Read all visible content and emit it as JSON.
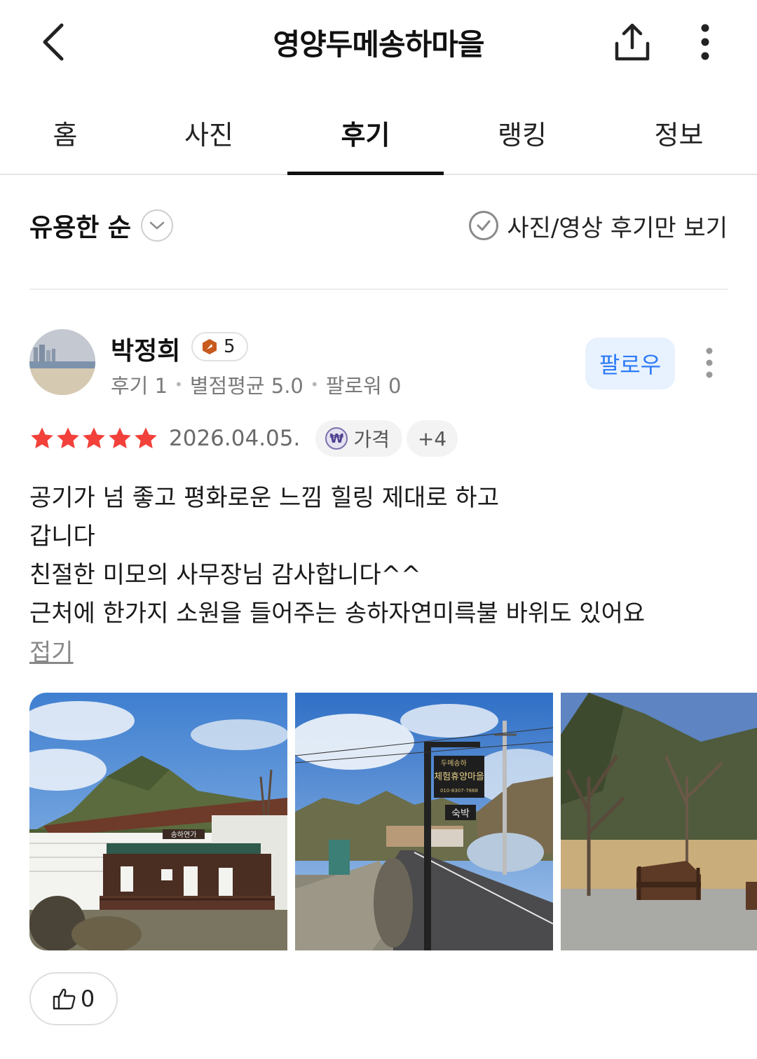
{
  "header": {
    "title": "영양두메송하마을",
    "back_icon": "chevron-left-icon",
    "share_icon": "share-icon",
    "more_icon": "more-vertical-icon"
  },
  "tabs": [
    {
      "label": "홈"
    },
    {
      "label": "사진"
    },
    {
      "label": "후기",
      "active": true
    },
    {
      "label": "랭킹"
    },
    {
      "label": "정보"
    }
  ],
  "sort": {
    "label": "유용한 순",
    "filter_label": "사진/영상 후기만 보기"
  },
  "review": {
    "author": "박정희",
    "level": "5",
    "stats": {
      "reviews": "후기 1",
      "rating_avg": "별점평균 5.0",
      "followers": "팔로워 0"
    },
    "follow_label": "팔로우",
    "rating": 5,
    "date": "2026.04.05.",
    "tag_icon_text": "₩",
    "tag": "가격",
    "more_tags": "+4",
    "text_lines": [
      "공기가 넘 좋고 평화로운 느낌 힐링 제대로 하고",
      "갑니다",
      "친절한 미모의 사무장님 감사합니다^^",
      "근처에 한가지 소원을 들어주는 송하자연미륵불 바위도 있어요"
    ],
    "collapse_label": "접기",
    "photos": {
      "photo1_sign": "송하연가",
      "photo2_sign_top": "두메송하",
      "photo2_sign_main": "체험휴양마을",
      "photo2_sign_phone": "010-8307-7868",
      "photo2_sign_lodging": "숙박"
    },
    "likes": "0"
  },
  "colors": {
    "accent_blue": "#2d7cf6",
    "follow_bg": "#e8f1fe",
    "star_red": "#f2403a"
  }
}
